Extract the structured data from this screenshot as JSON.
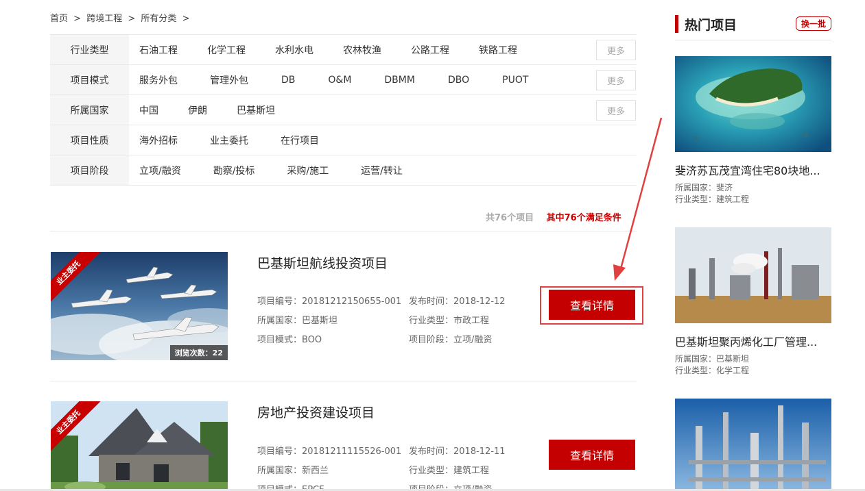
{
  "breadcrumb": {
    "home": "首页",
    "sep": ">",
    "level1": "跨境工程",
    "level2": "所有分类"
  },
  "filters": [
    {
      "label": "行业类型",
      "options": [
        "石油工程",
        "化学工程",
        "水利水电",
        "农林牧渔",
        "公路工程",
        "铁路工程"
      ],
      "more": "更多"
    },
    {
      "label": "项目模式",
      "options": [
        "服务外包",
        "管理外包",
        "DB",
        "O&M",
        "DBMM",
        "DBO",
        "PUOT"
      ],
      "more": "更多"
    },
    {
      "label": "所属国家",
      "options": [
        "中国",
        "伊朗",
        "巴基斯坦"
      ],
      "more": "更多"
    },
    {
      "label": "项目性质",
      "options": [
        "海外招标",
        "业主委托",
        "在行项目"
      ]
    },
    {
      "label": "项目阶段",
      "options": [
        "立项/融资",
        "勘察/投标",
        "采购/施工",
        "运营/转让"
      ]
    }
  ],
  "counts": {
    "total": "共76个项目",
    "match": "其中76个满足条件"
  },
  "projects": [
    {
      "ribbon": "业主委托",
      "views": "浏览次数：22",
      "title": "巴基斯坦航线投资项目",
      "code": "项目编号：20181212150655-001",
      "date": "发布时间：2018-12-12",
      "country": "所属国家：巴基斯坦",
      "industry": "行业类型：市政工程",
      "mode": "项目模式：BOO",
      "stage": "项目阶段：立项/融资",
      "button": "查看详情"
    },
    {
      "ribbon": "业主委托",
      "title": "房地产投资建设项目",
      "code": "项目编号：20181211115526-001",
      "date": "发布时间：2018-12-11",
      "country": "所属国家：新西兰",
      "industry": "行业类型：建筑工程",
      "mode": "项目模式：EPCF",
      "stage": "项目阶段：立项/融资",
      "button": "查看详情"
    }
  ],
  "sidebar": {
    "title": "热门项目",
    "swap": "换一批",
    "items": [
      {
        "title": "斐济苏瓦茂宜湾住宅80块地...",
        "country": "所属国家：斐济",
        "industry": "行业类型：建筑工程"
      },
      {
        "title": "巴基斯坦聚丙烯化工厂管理...",
        "country": "所属国家：巴基斯坦",
        "industry": "行业类型：化学工程"
      }
    ]
  },
  "colors": {
    "accent": "#c40000",
    "annotation": "#e04040"
  }
}
